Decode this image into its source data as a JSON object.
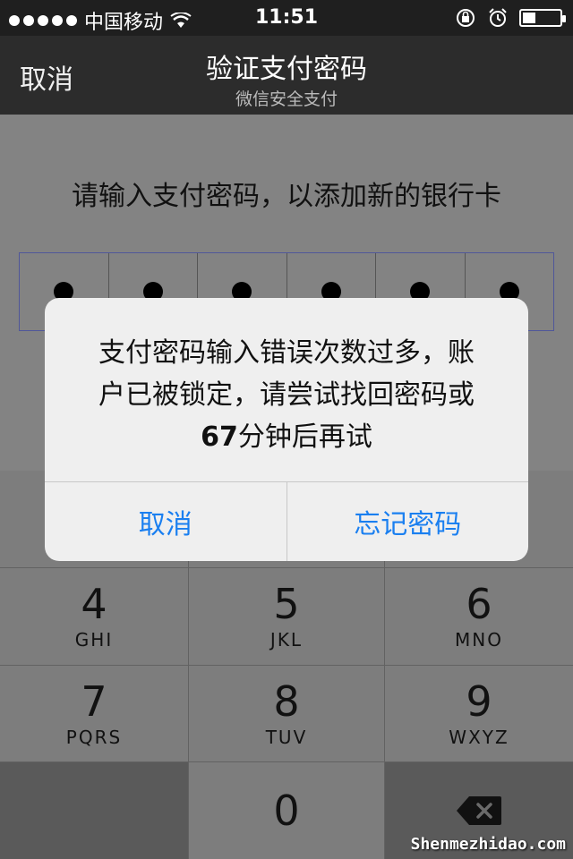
{
  "status": {
    "carrier": "中国移动",
    "time": "11:51",
    "battery_level": 0.35
  },
  "nav": {
    "cancel": "取消",
    "title": "验证支付密码",
    "subtitle": "微信安全支付"
  },
  "prompt": "请输入支付密码，以添加新的银行卡",
  "pin": {
    "filled": 6,
    "total": 6
  },
  "keypad": {
    "row2": [
      {
        "digit": "4",
        "letters": "GHI"
      },
      {
        "digit": "5",
        "letters": "JKL"
      },
      {
        "digit": "6",
        "letters": "MNO"
      }
    ],
    "row3": [
      {
        "digit": "7",
        "letters": "PQRS"
      },
      {
        "digit": "8",
        "letters": "TUV"
      },
      {
        "digit": "9",
        "letters": "WXYZ"
      }
    ],
    "zero": "0"
  },
  "alert": {
    "line1": "支付密码输入错误次数过多，账",
    "line2": "户已被锁定，请尝试找回密码或",
    "minutes": "67",
    "line3_rest": "分钟后再试",
    "cancel": "取消",
    "forgot": "忘记密码"
  },
  "watermark": "Shenmezhidao.com",
  "colors": {
    "accent": "#1a7ff0"
  }
}
